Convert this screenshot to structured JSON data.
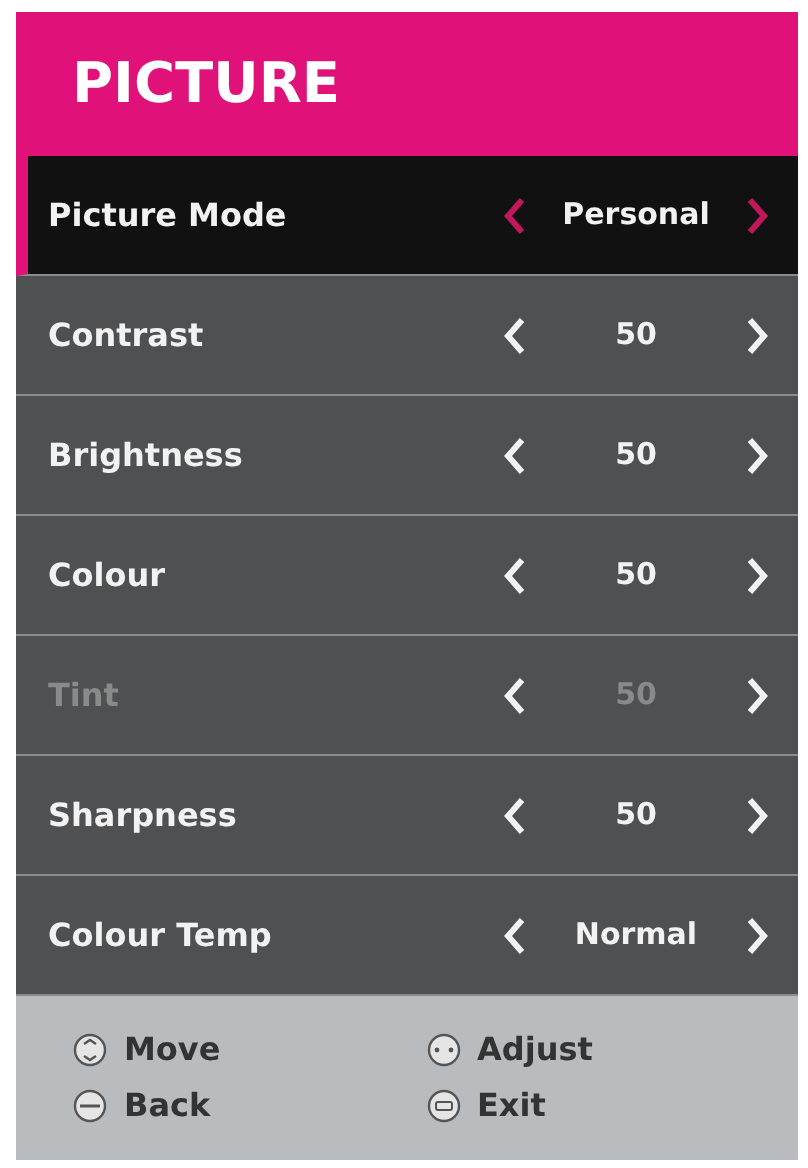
{
  "title": "PICTURE",
  "items": [
    {
      "label": "Picture Mode",
      "value": "Personal",
      "selected": true,
      "disabled": false
    },
    {
      "label": "Contrast",
      "value": "50",
      "selected": false,
      "disabled": false
    },
    {
      "label": "Brightness",
      "value": "50",
      "selected": false,
      "disabled": false
    },
    {
      "label": "Colour",
      "value": "50",
      "selected": false,
      "disabled": false
    },
    {
      "label": "Tint",
      "value": "50",
      "selected": false,
      "disabled": true
    },
    {
      "label": "Sharpness",
      "value": "50",
      "selected": false,
      "disabled": false
    },
    {
      "label": "Colour Temp",
      "value": "Normal",
      "selected": false,
      "disabled": false
    }
  ],
  "hints": [
    {
      "kind": "move",
      "label": "Move"
    },
    {
      "kind": "adjust",
      "label": "Adjust"
    },
    {
      "kind": "back",
      "label": "Back"
    },
    {
      "kind": "exit",
      "label": "Exit"
    }
  ]
}
